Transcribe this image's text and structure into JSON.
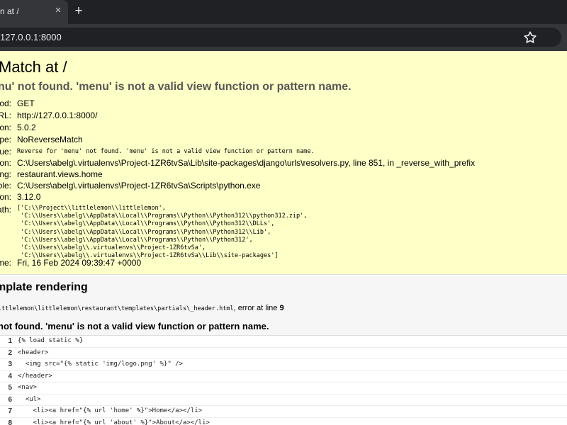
{
  "browser": {
    "tab_title": "n at /",
    "tab_close": "×",
    "new_tab": "+",
    "url": "127.0.0.1:8000",
    "star_icon": "bookmark-star-icon"
  },
  "error": {
    "title": "Match at /",
    "message": "nu' not found. 'menu' is not a valid view function or pattern name.",
    "meta": [
      {
        "label": "od:",
        "value": "GET"
      },
      {
        "label": "RL:",
        "value": "http://127.0.0.1:8000/"
      },
      {
        "label": "on:",
        "value": "5.0.2"
      },
      {
        "label": "pe:",
        "value": "NoReverseMatch"
      },
      {
        "label": "ue:",
        "value": "Reverse for 'menu' not found. 'menu' is not a valid view function or pattern name."
      },
      {
        "label": "on:",
        "value": "C:\\Users\\abelg\\.virtualenvs\\Project-1ZR6tvSa\\Lib\\site-packages\\django\\urls\\resolvers.py, line 851, in _reverse_with_prefix"
      },
      {
        "label": "ng:",
        "value": "restaurant.views.home"
      },
      {
        "label": "ble:",
        "value": "C:\\Users\\abelg\\.virtualenvs\\Project-1ZR6tvSa\\Scripts\\python.exe"
      },
      {
        "label": "on:",
        "value": "3.12.0"
      },
      {
        "label": "ath:",
        "value": "['C:\\\\Project\\\\littlelemon\\\\littlelemon',\n 'C:\\\\Users\\\\abelg\\\\AppData\\\\Local\\\\Programs\\\\Python\\\\Python312\\\\python312.zip',\n 'C:\\\\Users\\\\abelg\\\\AppData\\\\Local\\\\Programs\\\\Python\\\\Python312\\\\DLLs',\n 'C:\\\\Users\\\\abelg\\\\AppData\\\\Local\\\\Programs\\\\Python\\\\Python312\\\\Lib',\n 'C:\\\\Users\\\\abelg\\\\AppData\\\\Local\\\\Programs\\\\Python\\\\Python312',\n 'C:\\\\Users\\\\abelg\\\\.virtualenvs\\\\Project-1ZR6tvSa',\n 'C:\\\\Users\\\\abelg\\\\.virtualenvs\\\\Project-1ZR6tvSa\\\\Lib\\\\site-packages']"
      },
      {
        "label": "me:",
        "value": "Fri, 16 Feb 2024 09:39:47 +0000"
      }
    ]
  },
  "template": {
    "heading": "mplate rendering",
    "path": "ittlelemon\\littlelemon\\restaurant\\templates\\partials\\_header.html",
    "error_at": ", error at line ",
    "line": "9",
    "error": "not found. 'menu' is not a valid view function or pattern name.",
    "source": [
      {
        "num": "1",
        "code": "{% load static %}"
      },
      {
        "num": "2",
        "code": "<header>"
      },
      {
        "num": "3",
        "code": "  <img src=\"{% static 'img/logo.png' %}\" />"
      },
      {
        "num": "4",
        "code": "</header>"
      },
      {
        "num": "5",
        "code": "<nav>"
      },
      {
        "num": "6",
        "code": "  <ul>"
      },
      {
        "num": "7",
        "code": "    <li><a href=\"{% url 'home' %}\">Home</a></li>"
      },
      {
        "num": "8",
        "code": "    <li><a href=\"{% url 'about' %}\">About</a></li>"
      }
    ]
  },
  "colors": {
    "summary_bg": "#ffffc8",
    "template_bg": "#f6f6f6",
    "chrome_dark": "#202124",
    "chrome_tab": "#35363a"
  }
}
